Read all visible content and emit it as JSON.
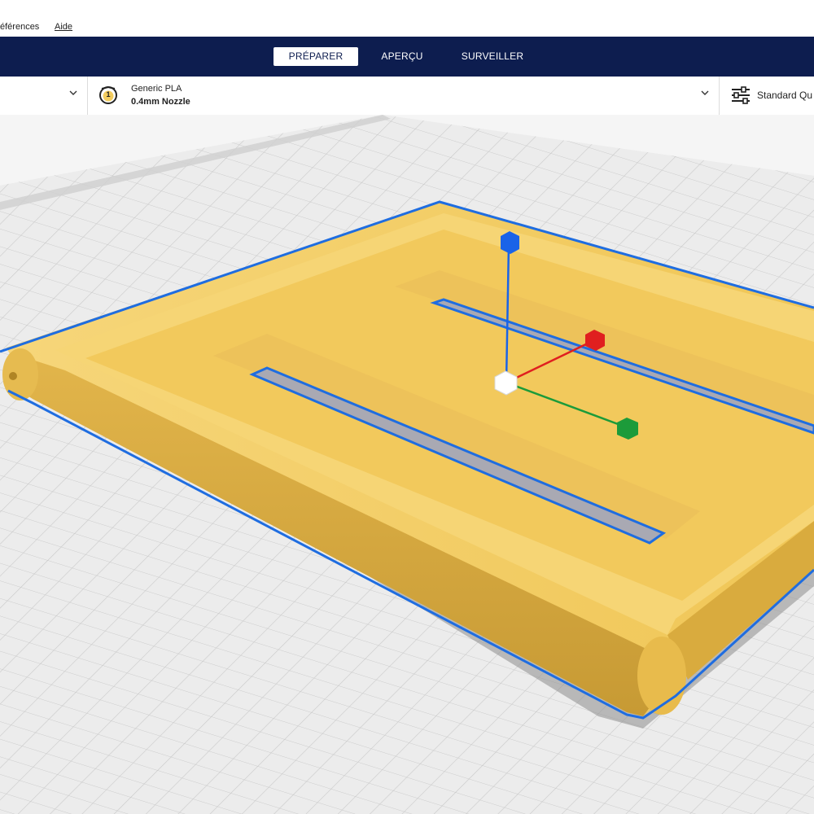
{
  "menu": {
    "preferences_label": "éférences",
    "help_label": "Aide"
  },
  "stages": {
    "prepare_label": "PRÉPARER",
    "preview_label": "APERÇU",
    "monitor_label": "SURVEILLER"
  },
  "material": {
    "extruder_number": "1",
    "name": "Generic PLA",
    "nozzle": "0.4mm Nozzle"
  },
  "print_settings": {
    "profile_label": "Standard Qu"
  },
  "colors": {
    "stage_bar": "#0d1d4f",
    "model": "#f3cc5e",
    "selection_outline": "#1f6de0",
    "axis_x": "#e01f1f",
    "axis_y": "#1c9b3a",
    "axis_z": "#1a63e8"
  },
  "icons": {
    "printer_dropdown": "chevron-down-icon",
    "material": "extruder-badge-icon",
    "settings": "sliders-icon",
    "gizmo": "move-gizmo-icon"
  }
}
